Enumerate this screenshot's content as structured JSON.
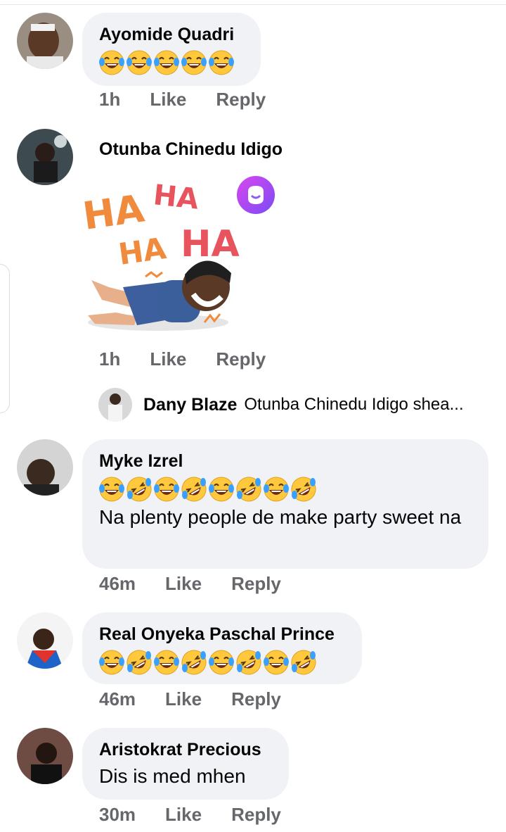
{
  "comments": [
    {
      "name": "Ayomide Quadri",
      "text": "",
      "emojis": [
        "joy",
        "joy",
        "joy",
        "joy",
        "joy"
      ],
      "time": "1h",
      "like": "Like",
      "reply": "Reply"
    },
    {
      "name": "Otunba Chinedu Idigo",
      "sticker": [
        "HA",
        "HA",
        "HA",
        "HA"
      ],
      "time": "1h",
      "like": "Like",
      "reply": "Reply",
      "reply_preview": {
        "name": "Dany Blaze",
        "text": "Otunba Chinedu Idigo shea..."
      }
    },
    {
      "name": "Myke Izrel",
      "emojis": [
        "joy",
        "rofl",
        "joy",
        "rofl",
        "joy",
        "rofl",
        "joy",
        "rofl"
      ],
      "text": "Na plenty people de make party sweet na",
      "time": "46m",
      "like": "Like",
      "reply": "Reply"
    },
    {
      "name": "Real Onyeka Paschal Prince",
      "emojis": [
        "joy",
        "rofl",
        "joy",
        "rofl",
        "joy",
        "rofl",
        "joy",
        "rofl"
      ],
      "time": "46m",
      "like": "Like",
      "reply": "Reply"
    },
    {
      "name": "Aristokrat Precious",
      "text": "Dis is med mhen",
      "time": "30m",
      "like": "Like",
      "reply": "Reply"
    }
  ],
  "colors": {
    "bubble": "#f0f2f5",
    "meta": "#65676b",
    "emoji_face": "#ffc83d",
    "tear": "#39a0ff"
  }
}
